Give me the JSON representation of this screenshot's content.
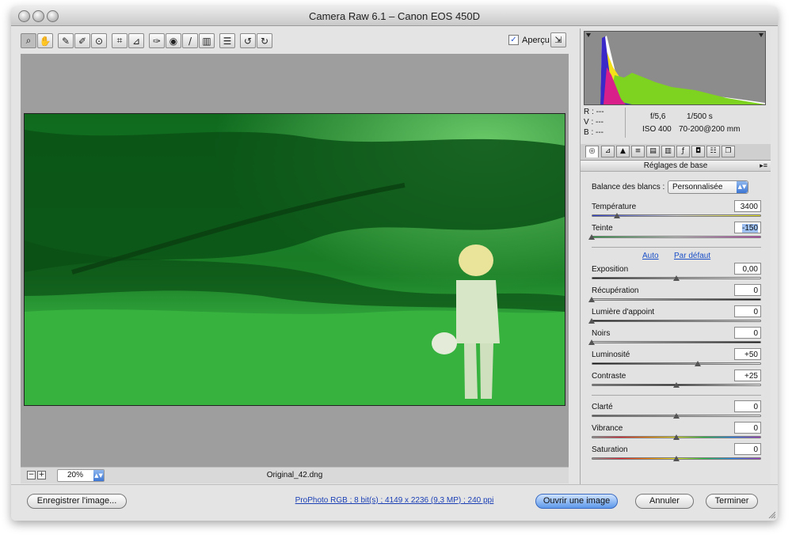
{
  "window": {
    "title": "Camera Raw 6.1  –  Canon EOS 450D"
  },
  "toolbar": {
    "tools": [
      "zoom-icon",
      "hand-icon",
      "eyedropper-icon",
      "color-sampler-icon",
      "target-adjustment-icon",
      "crop-icon",
      "straighten-icon",
      "spot-removal-icon",
      "red-eye-icon",
      "adjustment-brush-icon",
      "graduated-filter-icon",
      "preferences-icon",
      "rotate-left-icon",
      "rotate-right-icon"
    ],
    "preview_label": "Aperçu",
    "preview_checked": true
  },
  "canvas": {
    "zoom": "20%",
    "filename": "Original_42.dng"
  },
  "info": {
    "r_label": "R :",
    "r_value": "---",
    "g_label": "V :",
    "g_value": "---",
    "b_label": "B :",
    "b_value": "---",
    "aperture": "f/5,6",
    "shutter": "1/500 s",
    "iso": "ISO 400",
    "lens": "70-200@200 mm"
  },
  "panel": {
    "section_title": "Réglages de base",
    "white_balance_label": "Balance des blancs :",
    "white_balance_value": "Personnalisée",
    "auto_link": "Auto",
    "default_link": "Par défaut",
    "sliders_wb": [
      {
        "label": "Température",
        "value": "3400",
        "position": 0.15
      },
      {
        "label": "Teinte",
        "value": "-150",
        "position": 0.0
      }
    ],
    "sliders_tone": [
      {
        "label": "Exposition",
        "value": "0,00",
        "position": 0.5
      },
      {
        "label": "Récupération",
        "value": "0",
        "position": 0.0
      },
      {
        "label": "Lumière d'appoint",
        "value": "0",
        "position": 0.0
      },
      {
        "label": "Noirs",
        "value": "0",
        "position": 0.0
      },
      {
        "label": "Luminosité",
        "value": "+50",
        "position": 0.625
      },
      {
        "label": "Contraste",
        "value": "+25",
        "position": 0.5
      }
    ],
    "sliders_presence": [
      {
        "label": "Clarté",
        "value": "0",
        "position": 0.5
      },
      {
        "label": "Vibrance",
        "value": "0",
        "position": 0.5
      },
      {
        "label": "Saturation",
        "value": "0",
        "position": 0.5
      }
    ]
  },
  "bottom": {
    "save_label": "Enregistrer l'image...",
    "workflow_info": "ProPhoto RGB ; 8 bit(s) ; 4149 x 2236 (9,3 MP) ; 240 ppi",
    "open_label": "Ouvrir une image",
    "cancel_label": "Annuler",
    "done_label": "Terminer"
  },
  "colors": {
    "accent": "#3c76d4",
    "photo_green": "#1f8a2a"
  }
}
